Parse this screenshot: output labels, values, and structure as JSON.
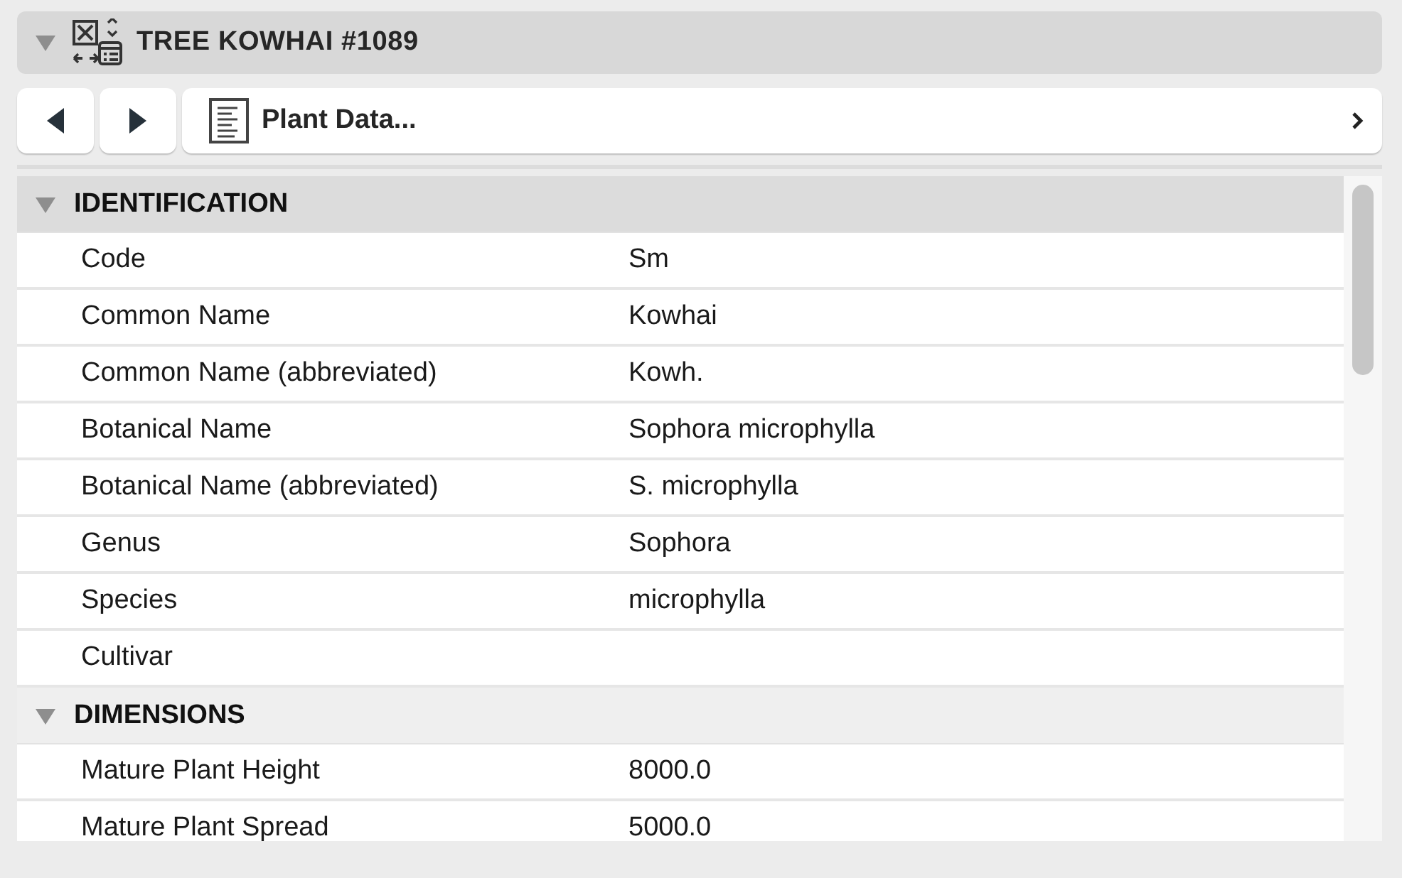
{
  "header": {
    "title": "TREE KOWHAI #1089",
    "expanded": true
  },
  "nav": {
    "panel_label": "Plant Data..."
  },
  "sections": [
    {
      "title": "IDENTIFICATION",
      "expanded": true,
      "selected": true,
      "rows": [
        {
          "label": "Code",
          "value": "Sm"
        },
        {
          "label": "Common Name",
          "value": "Kowhai"
        },
        {
          "label": "Common Name (abbreviated)",
          "value": "Kowh."
        },
        {
          "label": "Botanical Name",
          "value": "Sophora microphylla"
        },
        {
          "label": "Botanical Name (abbreviated)",
          "value": "S. microphylla"
        },
        {
          "label": "Genus",
          "value": "Sophora"
        },
        {
          "label": "Species",
          "value": "microphylla"
        },
        {
          "label": "Cultivar"
        }
      ]
    },
    {
      "title": "DIMENSIONS",
      "expanded": true,
      "selected": false,
      "rows": [
        {
          "label": "Mature Plant Height",
          "value": "8000.0"
        },
        {
          "label": "Mature Plant Spread",
          "value": "5000.0"
        }
      ]
    }
  ]
}
